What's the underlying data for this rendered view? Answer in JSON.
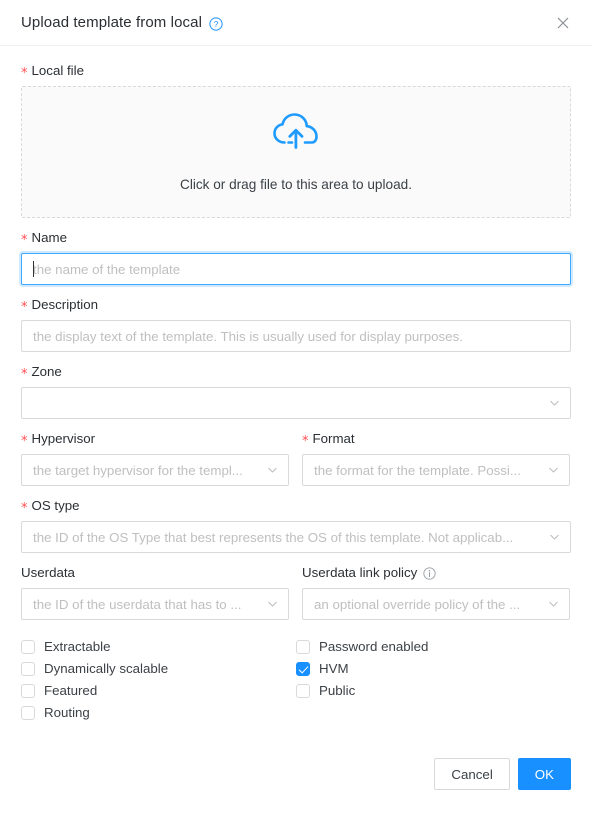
{
  "header": {
    "title": "Upload template from local",
    "help_icon": "question-circle-icon",
    "close_icon": "close-icon"
  },
  "form": {
    "local_file": {
      "label": "Local file",
      "required": true,
      "upload_icon": "cloud-upload-icon",
      "dropzone_text": "Click or drag file to this area to upload."
    },
    "name": {
      "label": "Name",
      "required": true,
      "value": "",
      "placeholder": "the name of the template",
      "focused": true
    },
    "description": {
      "label": "Description",
      "required": true,
      "value": "",
      "placeholder": "the display text of the template. This is usually used for display purposes."
    },
    "zone": {
      "label": "Zone",
      "required": true,
      "value": "",
      "placeholder": ""
    },
    "hypervisor": {
      "label": "Hypervisor",
      "required": true,
      "value": "",
      "placeholder": "the target hypervisor for the templ..."
    },
    "format": {
      "label": "Format",
      "required": true,
      "value": "",
      "placeholder": "the format for the template. Possi..."
    },
    "os_type": {
      "label": "OS type",
      "required": true,
      "value": "",
      "placeholder": "the ID of the OS Type that best represents the OS of this template. Not applicab..."
    },
    "userdata": {
      "label": "Userdata",
      "required": false,
      "value": "",
      "placeholder": "the ID of the userdata that has to ..."
    },
    "userdata_link_policy": {
      "label": "Userdata link policy",
      "required": false,
      "info_icon": "info-circle-icon",
      "value": "",
      "placeholder": "an optional override policy of the ..."
    }
  },
  "checkboxes": {
    "left_column": [
      {
        "name": "extractable",
        "label": "Extractable",
        "checked": false
      },
      {
        "name": "dynamically-scalable",
        "label": "Dynamically scalable",
        "checked": false
      },
      {
        "name": "featured",
        "label": "Featured",
        "checked": false
      },
      {
        "name": "routing",
        "label": "Routing",
        "checked": false
      }
    ],
    "right_column": [
      {
        "name": "password-enabled",
        "label": "Password enabled",
        "checked": false
      },
      {
        "name": "hvm",
        "label": "HVM",
        "checked": true
      },
      {
        "name": "public",
        "label": "Public",
        "checked": false
      }
    ]
  },
  "footer": {
    "cancel_label": "Cancel",
    "ok_label": "OK"
  },
  "colors": {
    "primary": "#1890ff",
    "required_star": "#ff4d4f",
    "placeholder": "#bfbfbf",
    "border": "#d9d9d9",
    "text": "#2b2f33"
  }
}
